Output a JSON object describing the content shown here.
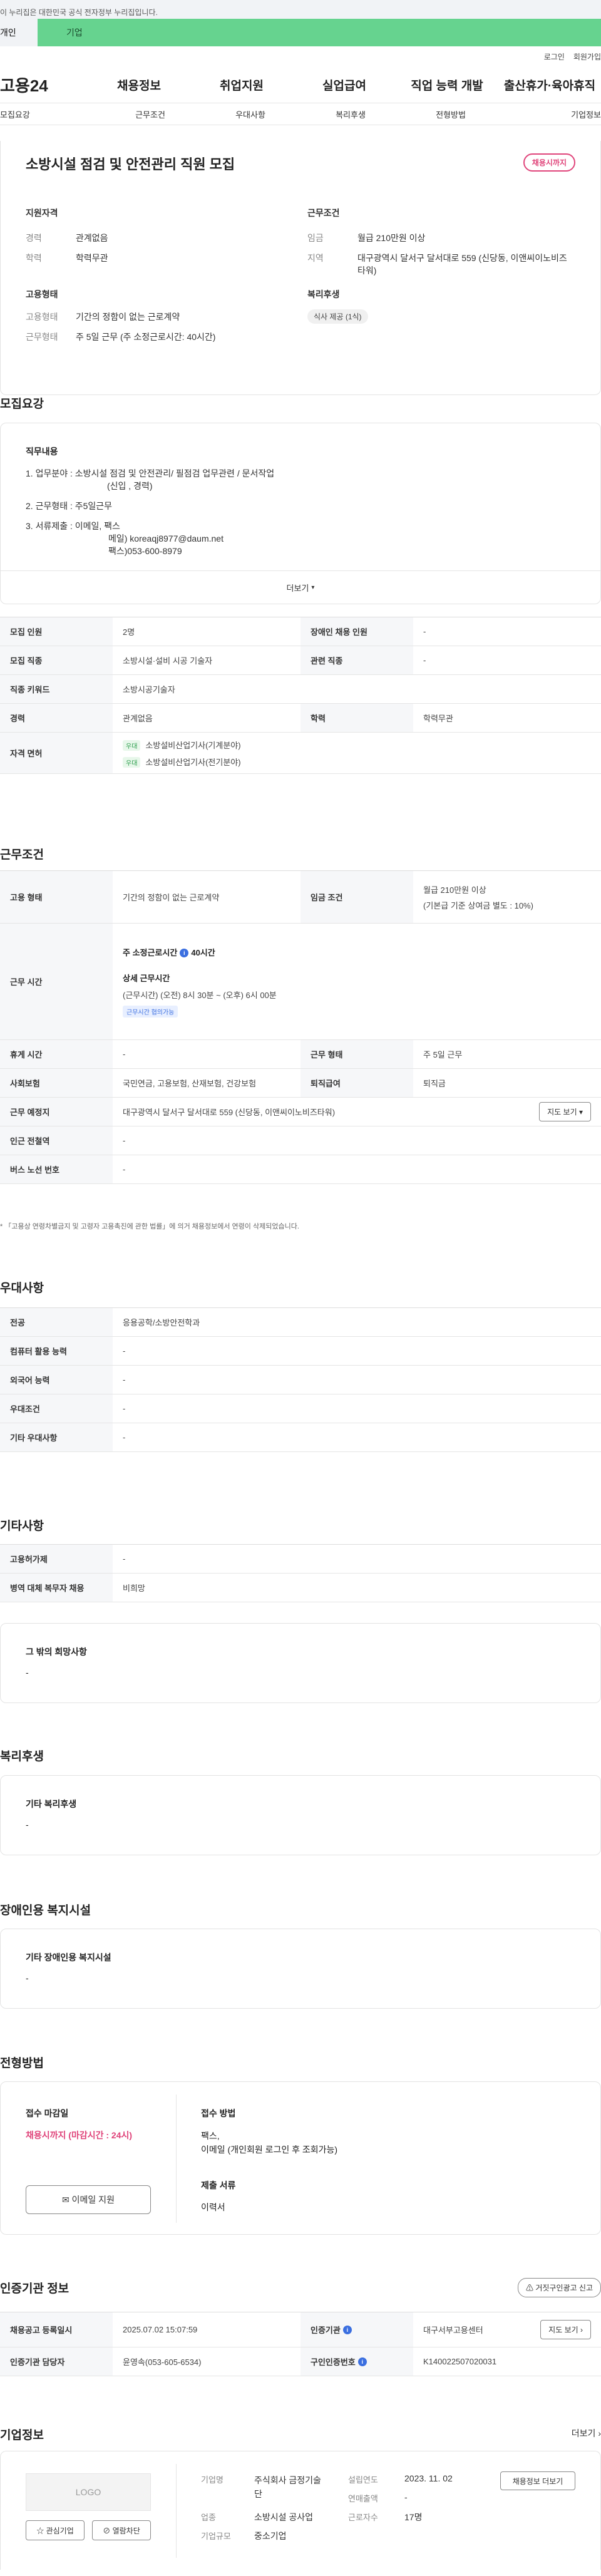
{
  "gov_banner": "이 누리집은 대한민국 공식 전자정부 누리집입니다.",
  "user_tabs": [
    "개인",
    "기업"
  ],
  "util": [
    "로그인",
    "회원가입"
  ],
  "gnb": {
    "logo": "고용24",
    "menu": [
      "채용정보",
      "취업지원",
      "실업급여",
      "직업 능력 개발",
      "출산휴가·육아휴직"
    ]
  },
  "lnb": [
    "모집요강",
    "근무조건",
    "우대사항",
    "복리후생",
    "전형방법",
    "기업정보"
  ],
  "summary": {
    "title": "소방시설 점검 및 안전관리 직원 모집",
    "badge": "채용시까지",
    "qual_label": "지원자격",
    "qual": [
      {
        "k": "경력",
        "v": "관계없음"
      },
      {
        "k": "학력",
        "v": "학력무관"
      }
    ],
    "cond_label": "근무조건",
    "cond": [
      {
        "k": "임금",
        "v": "월급 210만원 이상"
      },
      {
        "k": "지역",
        "v": "대구광역시 달서구 달서대로 559 (신당동, 이앤씨이노비즈타워)"
      }
    ],
    "emp_label": "고용형태",
    "emp": [
      {
        "k": "고용형태",
        "v": "기간의 정함이 없는 근로계약"
      },
      {
        "k": "근무형태",
        "v": "주 5일 근무 (주 소정근로시간: 40시간)"
      }
    ],
    "welfare_label": "복리후생",
    "welfare_chip": "식사 제공 (1식)"
  },
  "recruit": {
    "heading": "모집요강",
    "duty_label": "직무내용",
    "duty_lines": [
      "1. 업무분야 : 소방시설 점검 및 안전관리/ 필점검 업무관련 / 문서작업",
      "(신입 , 경력)",
      "2. 근무형태 : 주5일근무",
      "3. 서류제출 : 이메일, 팩스",
      "메일) koreaqj8977@daum.net",
      "팩스)053-600-8979"
    ],
    "more": "더보기",
    "rows": [
      {
        "k1": "모집 인원",
        "v1": "2명",
        "k2": "장애인 채용 인원",
        "v2": "-"
      },
      {
        "k1": "모집 직종",
        "v1": "소방시설·설비 시공 기술자",
        "k2": "관련 직종",
        "v2": "-"
      }
    ],
    "keyword_k": "직종 키워드",
    "keyword_v": "소방시공기술자",
    "career_k": "경력",
    "career_v": "관계없음",
    "edu_k": "학력",
    "edu_v": "학력무관",
    "license_k": "자격 면허",
    "license_tag": "우대",
    "licenses": [
      "소방설비산업기사(기계분야)",
      "소방설비산업기사(전기분야)"
    ]
  },
  "work": {
    "heading": "근무조건",
    "emp_k": "고용 형태",
    "emp_v": "기간의 정함이 없는 근로계약",
    "wage_k": "임금 조건",
    "wage_v1": "월급 210만원 이상",
    "wage_v2": "(기본급 기준 상여금 별도 : 10%)",
    "time_k": "근무 시간",
    "time_title": "주 소정근로시간",
    "time_hours": "40시간",
    "time_detail_title": "상세 근무시간",
    "time_detail": "(근무시간) (오전) 8시 30분 ~ (오후) 6시 00분",
    "time_tag": "근무시간 협의가능",
    "rest_k": "휴게 시간",
    "rest_v": "-",
    "form_k": "근무 형태",
    "form_v": "주 5일 근무",
    "ins_k": "사회보험",
    "ins_v": "국민연금, 고용보험, 산재보험, 건강보험",
    "ret_k": "퇴직급여",
    "ret_v": "퇴직금",
    "loc_k": "근무 예정지",
    "loc_v": "대구광역시 달서구 달서대로 559 (신당동, 이앤씨이노비즈타워)",
    "map_btn": "지도 보기",
    "subway_k": "인근 전철역",
    "subway_v": "-",
    "bus_k": "버스 노선 번호",
    "bus_v": "-",
    "note": "* 「고용상 연령차별금지 및 고령자 고용촉진에 관한 법률」에 의거 채용정보에서 연령이 삭제되었습니다."
  },
  "pref": {
    "heading": "우대사항",
    "rows": [
      {
        "k": "전공",
        "v": "응용공학/소방안전학과"
      },
      {
        "k": "컴퓨터 활용 능력",
        "v": "-"
      },
      {
        "k": "외국어 능력",
        "v": "-"
      },
      {
        "k": "우대조건",
        "v": "-"
      },
      {
        "k": "기타 우대사항",
        "v": "-"
      }
    ]
  },
  "etc": {
    "heading": "기타사항",
    "rows": [
      {
        "k": "고용허가제",
        "v": "-"
      },
      {
        "k": "병역 대체 복무자 채용",
        "v": "비희망"
      }
    ],
    "other_label": "그 밖의 희망사항",
    "other_v": "-"
  },
  "benefit": {
    "heading": "복리후생",
    "label": "기타 복리후생",
    "v": "-"
  },
  "disab": {
    "heading": "장애인용 복지시설",
    "label": "기타 장애인용 복지시설",
    "v": "-"
  },
  "apply": {
    "heading": "전형방법",
    "deadline_label": "접수 마감일",
    "deadline_v": "채용시까지 (마감시간 : 24시)",
    "method_label": "접수 방법",
    "method_v1": "팩스,",
    "method_v2": "이메일 (개인회원 로그인 후 조회가능)",
    "docs_label": "제출 서류",
    "docs_v": "이력서",
    "email_btn": "이메일 지원"
  },
  "agency": {
    "heading": "인증기관 정보",
    "report_btn": "거짓구인광고 신고",
    "reg_k": "채용공고 등록일시",
    "reg_v": "2025.07.02 15:07:59",
    "org_k": "인증기관",
    "org_v": "대구서부고용센터",
    "map_btn": "지도 보기",
    "staff_k": "인증기관 담당자",
    "staff_v": "윤영속(053-605-6534)",
    "no_k": "구인인증번호",
    "no_v": "K140022507020031"
  },
  "company": {
    "heading": "기업정보",
    "more": "더보기",
    "logo": "LOGO",
    "fav_btn": "관심기업",
    "block_btn": "열람차단",
    "name_k": "기업명",
    "name_v": "주식회사 금정기술단",
    "ind_k": "업종",
    "ind_v": "소방시설 공사업",
    "size_k": "기업규모",
    "size_v": "중소기업",
    "est_k": "설립연도",
    "est_v": "2023. 11. 02",
    "sales_k": "연매출액",
    "sales_v": "-",
    "emp_k": "근로자수",
    "emp_v": "17명",
    "jobs_btn": "채용정보 더보기"
  }
}
